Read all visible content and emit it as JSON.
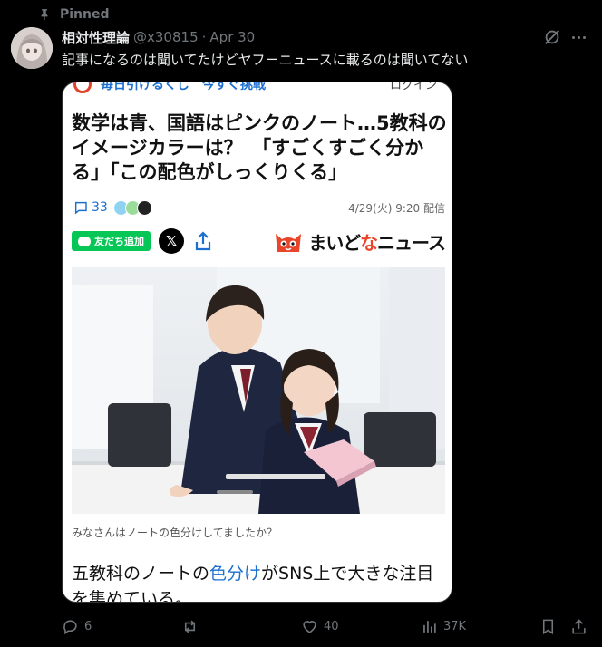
{
  "pinned": {
    "label": "Pinned"
  },
  "tweet": {
    "author_name": "相対性理論",
    "handle": "@x30815",
    "separator": "·",
    "date": "Apr 30",
    "text": "記事になるのは聞いてたけどヤフーニュースに載るのは聞いてない"
  },
  "article": {
    "top_text": "毎日引けるくじ　今すぐ挑戦",
    "top_login": "ログイン",
    "headline": "数学は青、国語はピンクのノート…5教科のイメージカラーは？　「すごくすごく分かる」「この配色がしっくりくる」",
    "comment_count": "33",
    "published": "4/29(火) 9:20 配信",
    "line_label": "友だち追加",
    "x_label": "𝕏",
    "logo_prefix": "まいど",
    "logo_mid": "な",
    "logo_suffix": "ニュース",
    "caption": "みなさんはノートの色分けしてましたか？",
    "lede_before": "五教科のノートの",
    "lede_highlight": "色分け",
    "lede_after": "がSNS上で大きな注目を集めている。"
  },
  "actions": {
    "replies": "6",
    "likes": "40",
    "views": "37K"
  },
  "icons": {
    "pinned": "pin-icon",
    "grok": "grok-icon",
    "more": "more-icon",
    "reply": "reply-icon",
    "retweet": "retweet-icon",
    "like": "heart-icon",
    "views": "views-icon",
    "bookmark": "bookmark-icon",
    "share": "share-icon"
  },
  "colors": {
    "background": "#000000",
    "text": "#e7e9ea",
    "muted": "#71767b",
    "link_blue": "#1d6fd0",
    "line_green": "#06c755",
    "logo_red": "#e8452a"
  }
}
